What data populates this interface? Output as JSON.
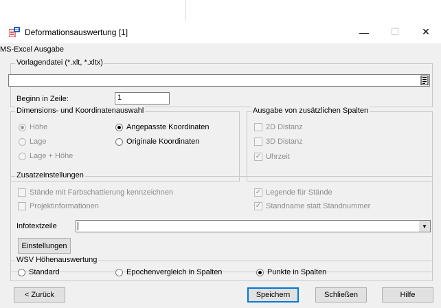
{
  "window": {
    "title": "Deformationsauswertung [1]",
    "controls": {
      "minimize": "—",
      "maximize": "☐",
      "close": "✕"
    }
  },
  "section_label": "MS-Excel Ausgabe",
  "template_group": {
    "legend": "Vorlagendatei (*.xlt, *.xltx)",
    "file_value": "",
    "start_row_label": "Beginn in Zeile:",
    "start_row_value": "1"
  },
  "dimension_group": {
    "legend": "Dimensions- und Koordinatenauswahl",
    "options": {
      "hoehe": "Höhe",
      "lage": "Lage",
      "lage_hoehe": "Lage + Höhe",
      "angepasste": "Angepasste Koordinaten",
      "originale": "Originale Koordinaten"
    }
  },
  "extra_columns_group": {
    "legend": "Ausgabe von zusätzlichen Spalten",
    "options": {
      "distanz_2d": "2D Distanz",
      "distanz_3d": "3D Distanz",
      "uhrzeit": "Uhrzeit"
    }
  },
  "additional_settings_group": {
    "legend": "Zusatzeinstellungen",
    "options": {
      "farbschattierung": "Stände mit Farbschattierung kennzeichnen",
      "projektinfo": "Projektinformationen",
      "legende": "Legende für Stände",
      "standname": "Standname statt Standnummer"
    },
    "info_label": "Infotextzeile",
    "info_value": "",
    "settings_button": "Einstellungen"
  },
  "wsv_group": {
    "legend": "WSV Höhenauswertung",
    "options": {
      "standard": "Standard",
      "epochen": "Epochenvergleich in Spalten",
      "punkte": "Punkte in Spalten"
    }
  },
  "buttons": {
    "back": "< Zurück",
    "save": "Speichern",
    "close": "Schließen",
    "help": "Hilfe"
  },
  "colors": {
    "accent": "#0078d7",
    "window_bg": "#f0f0f0",
    "disabled_text": "#8c8c8c"
  }
}
